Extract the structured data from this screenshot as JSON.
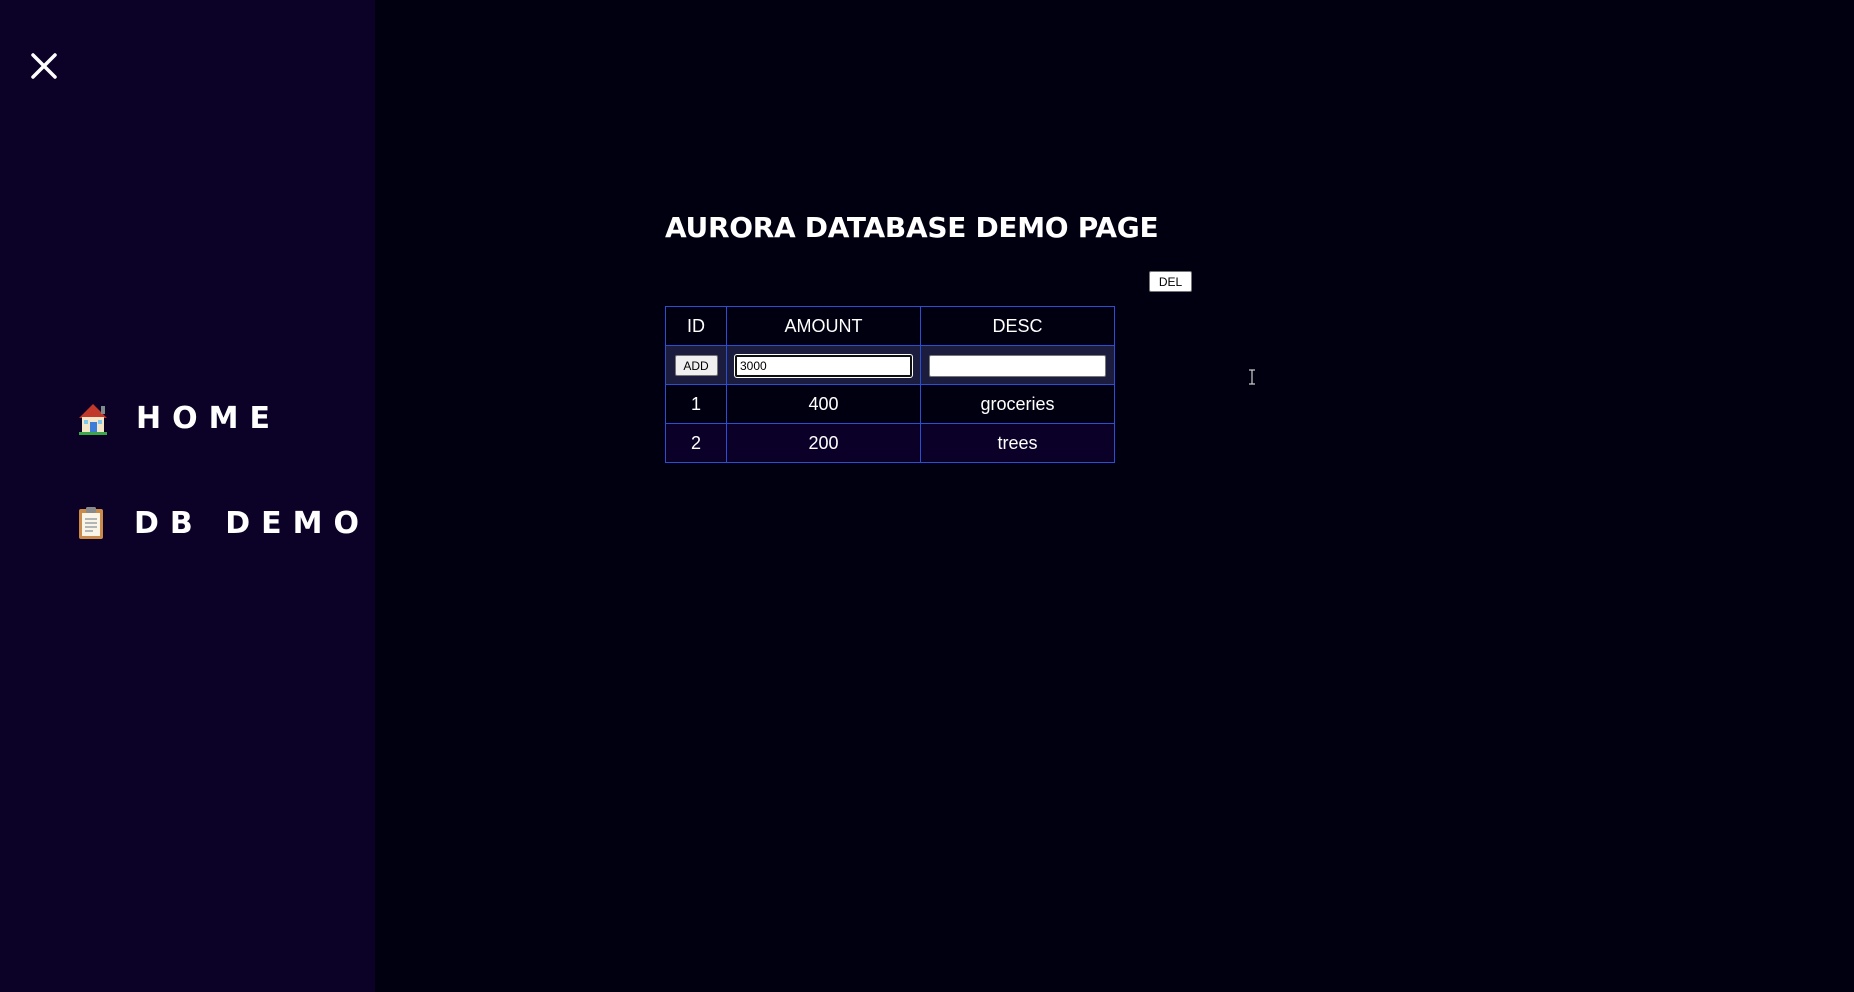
{
  "sidebar": {
    "close_icon": "close-icon",
    "items": [
      {
        "icon": "house-icon",
        "label": "HOME"
      },
      {
        "icon": "clipboard-icon",
        "label": "DB DEMO"
      }
    ]
  },
  "main": {
    "title": "AURORA DATABASE DEMO PAGE",
    "del_label": "DEL",
    "table": {
      "headers": [
        "ID",
        "AMOUNT",
        "DESC"
      ],
      "add_label": "ADD",
      "amount_input_value": "3000",
      "desc_input_value": "",
      "rows": [
        {
          "id": "1",
          "amount": "400",
          "desc": "groceries"
        },
        {
          "id": "2",
          "amount": "200",
          "desc": "trees"
        }
      ]
    }
  },
  "colors": {
    "page_bg": "#010011",
    "sidebar_bg": "#0c0127",
    "table_border": "#2a4fd4",
    "input_row_bg": "#1b1c3e",
    "alt_row_bg": "#0a0028",
    "text": "#ffffff"
  }
}
